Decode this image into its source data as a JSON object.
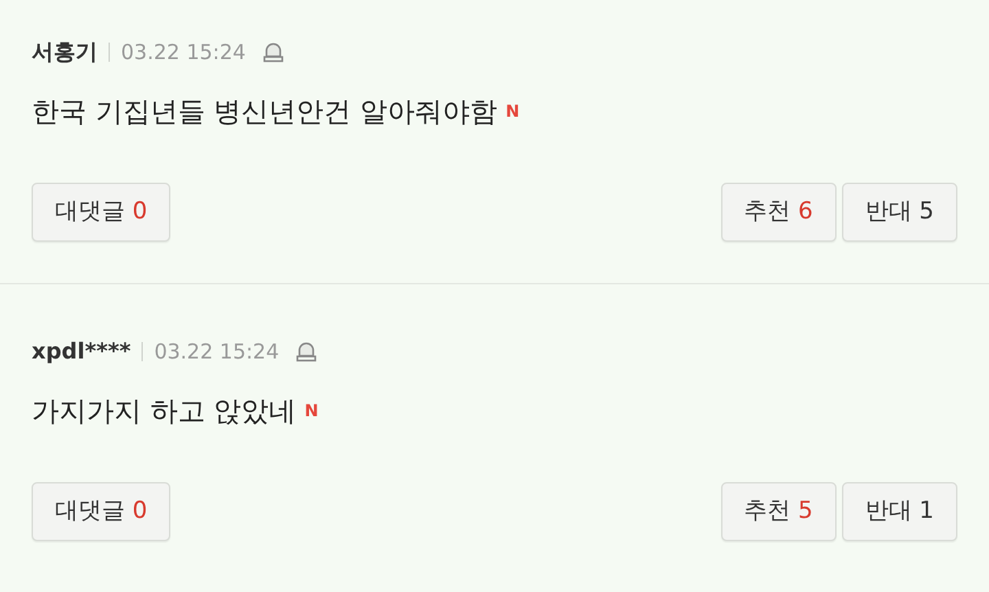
{
  "comments": [
    {
      "author": "서홍기",
      "time": "03.22 15:24",
      "text": "한국 기집년들 병신년안건 알아줘야함",
      "new_badge": "N",
      "reply": {
        "label": "대댓글",
        "count": "0"
      },
      "like": {
        "label": "추천",
        "count": "6"
      },
      "dislike": {
        "label": "반대",
        "count": "5"
      }
    },
    {
      "author": "xpdl****",
      "time": "03.22 15:24",
      "text": "가지가지 하고 앉았네",
      "new_badge": "N",
      "reply": {
        "label": "대댓글",
        "count": "0"
      },
      "like": {
        "label": "추천",
        "count": "5"
      },
      "dislike": {
        "label": "반대",
        "count": "1"
      }
    }
  ]
}
